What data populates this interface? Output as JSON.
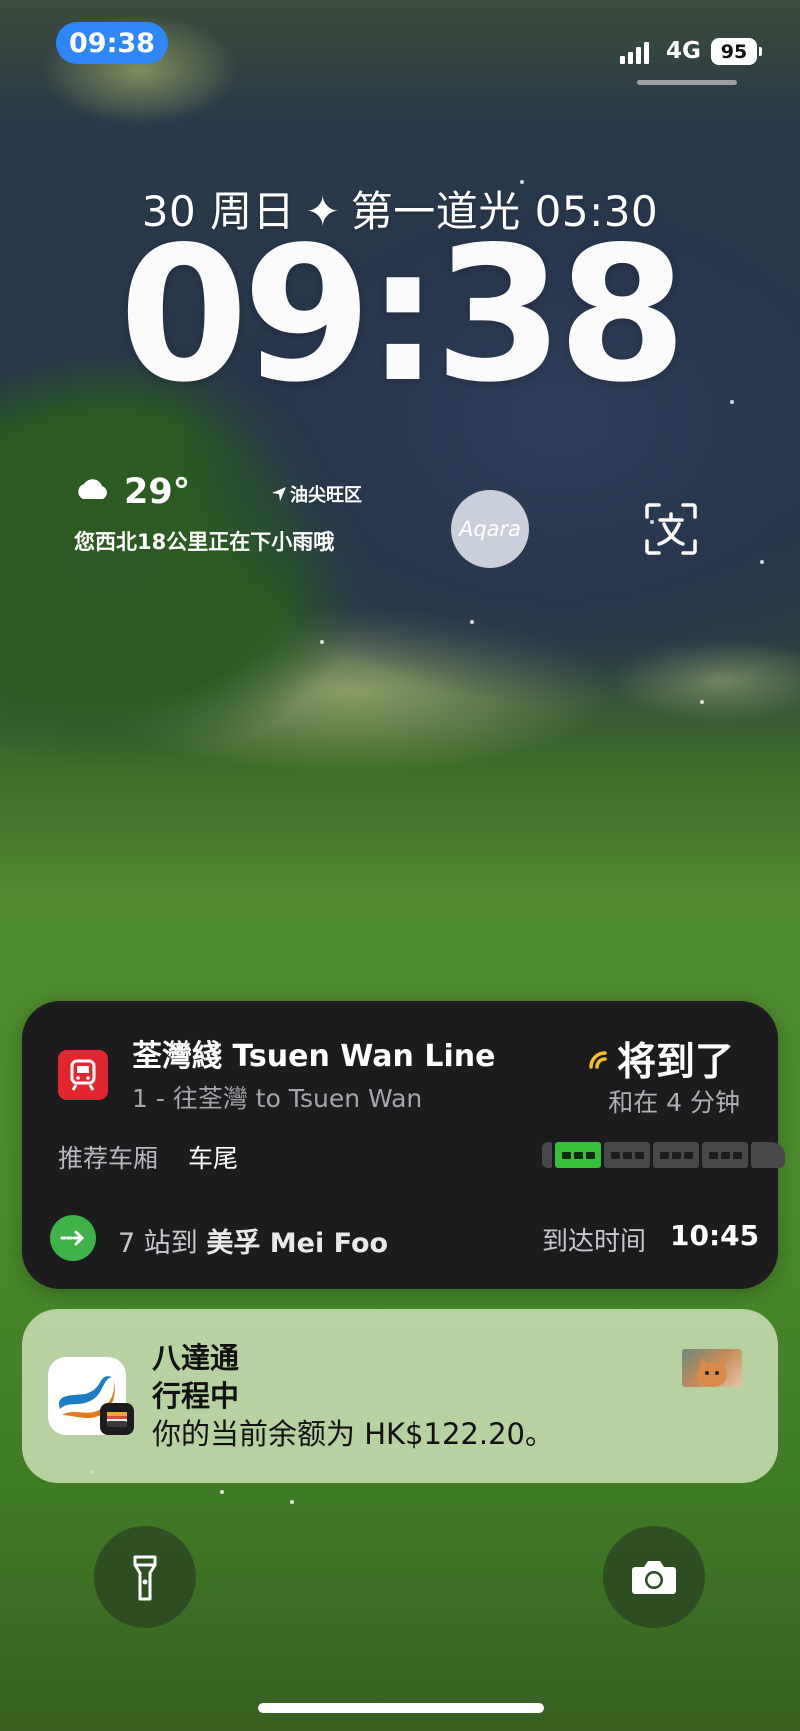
{
  "status_bar": {
    "time": "09:38",
    "network": "4G",
    "battery": "95"
  },
  "lock": {
    "date": "30 周日",
    "sparkle": "✦",
    "sunrise": "第一道光 05:30",
    "clock": "09:38"
  },
  "weather": {
    "temperature": "29°",
    "location": "油尖旺区",
    "forecast": "您西北18公里正在下小雨哦",
    "icon": "cloud-icon"
  },
  "widgets": {
    "aqara_label": "Aqara",
    "translate_icon": "translate-icon"
  },
  "mtr": {
    "line_name": "荃灣綫 Tsuen Wan Line",
    "direction": "1 - 往荃灣 to Tsuen Wan",
    "status": "将到了",
    "eta": "和在 4 分钟",
    "car_label": "推荐车厢",
    "car_value": "车尾",
    "recommended_car_index": 1,
    "car_count": 4,
    "stops_prefix": "7 站到",
    "stops_dest": "美孚 Mei Foo",
    "arrive_label": "到达时间",
    "arrive_time": "10:45",
    "accent": "#36c13b",
    "brand_color": "#e2262f"
  },
  "notification": {
    "title": "八達通",
    "subtitle": "行程中",
    "body": "你的当前余额为 HK$122.20。"
  },
  "controls": {
    "left": "flashlight-icon",
    "right": "camera-icon"
  }
}
